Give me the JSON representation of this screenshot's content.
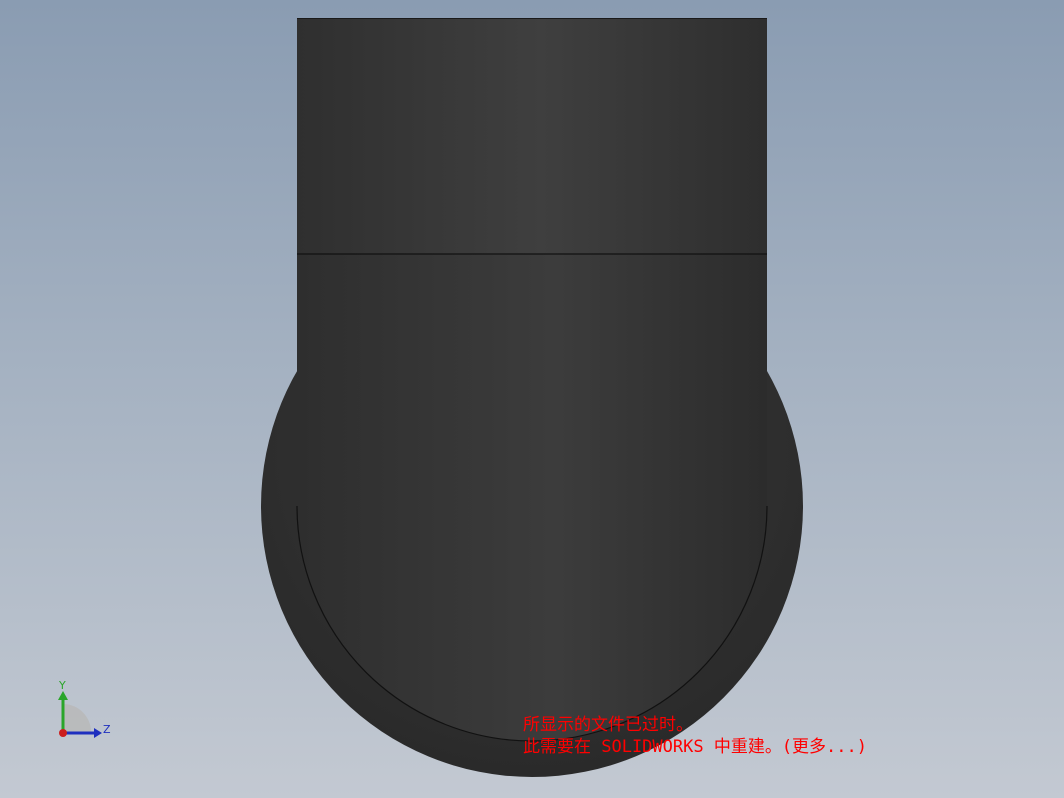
{
  "viewport": {
    "background_top": "#8a9cb2",
    "background_bottom": "#c3c9d2",
    "model_color": "#333333"
  },
  "triad": {
    "y_label": "Y",
    "z_label": "Z",
    "y_color": "#2aa52a",
    "z_color": "#1e2fbf",
    "x_color": "#cc1e1e"
  },
  "warning": {
    "color": "#ff0000",
    "line1": "所显示的文件已过时。",
    "line2": "此需要在 SOLIDWORKS 中重建。(更多...)"
  }
}
